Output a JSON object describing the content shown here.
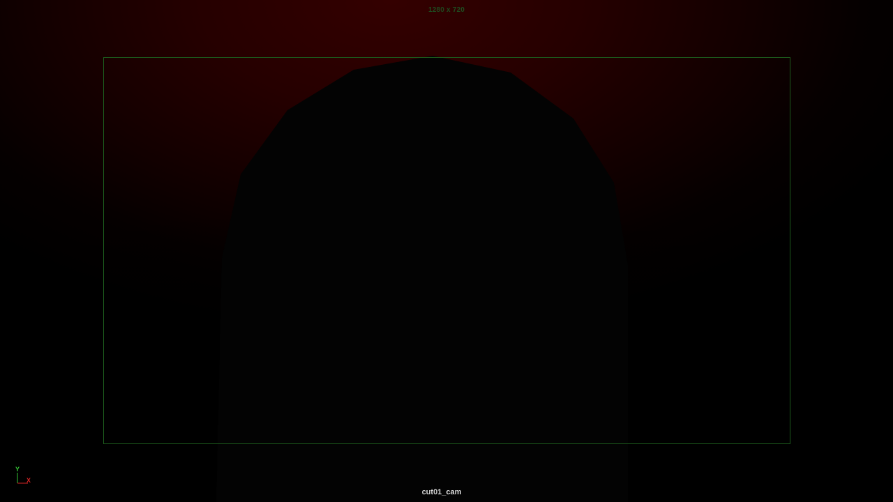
{
  "viewport": {
    "resolution_label": "1280 x 720",
    "camera_name": "cut01_cam",
    "axes": {
      "y_label": "Y",
      "x_label": "X"
    }
  },
  "colors": {
    "background_glow": "#340000",
    "resolution_gate": "#1c5a1c",
    "resolution_text": "#1f4a1f",
    "camera_text": "#d8d8d8",
    "axis_y": "#35c435",
    "axis_x": "#d42424"
  }
}
